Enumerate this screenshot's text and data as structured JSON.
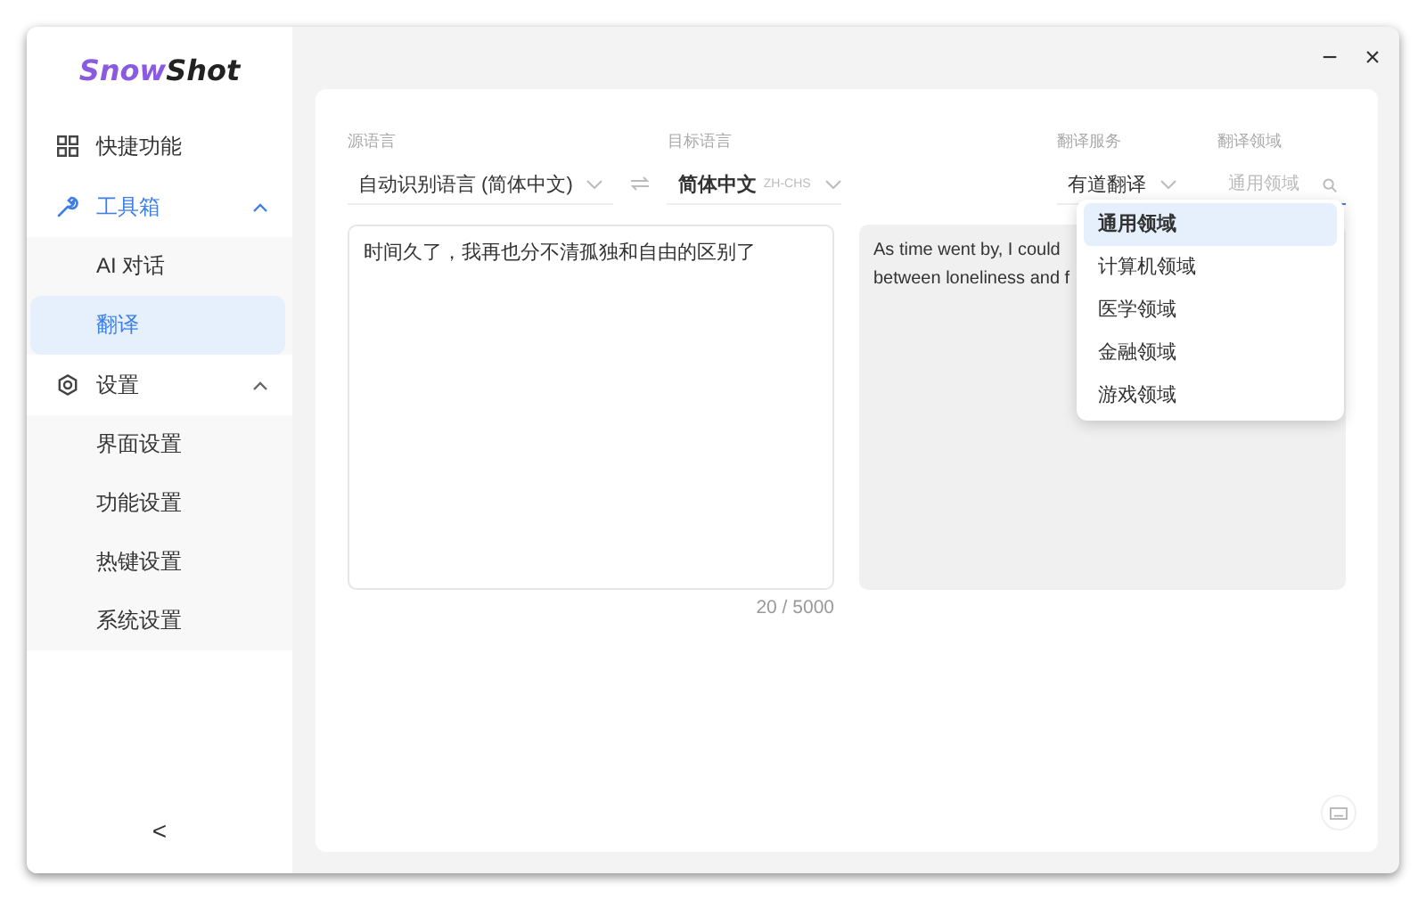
{
  "logo": {
    "part_a": "Snow",
    "part_b": "Shot"
  },
  "sidebar": [
    {
      "label": "快捷功能"
    },
    {
      "label": "工具箱",
      "expanded": true,
      "children": [
        {
          "label": "AI 对话",
          "selected": false
        },
        {
          "label": "翻译",
          "selected": true
        }
      ]
    },
    {
      "label": "设置",
      "expanded": true,
      "children": [
        {
          "label": "界面设置",
          "selected": false
        },
        {
          "label": "功能设置",
          "selected": false
        },
        {
          "label": "热键设置",
          "selected": false
        },
        {
          "label": "系统设置",
          "selected": false
        }
      ]
    }
  ],
  "collapse_button": "<",
  "window_controls": {
    "minimize": "−",
    "close": "×"
  },
  "source_language": {
    "label": "源语言",
    "value": "自动识别语言 (简体中文)"
  },
  "target_language": {
    "label": "目标语言",
    "value": "简体中文",
    "code": "ZH-CHS"
  },
  "service": {
    "label": "翻译服务",
    "value": "有道翻译"
  },
  "domain": {
    "label": "翻译领域",
    "placeholder": "通用领域",
    "open": true,
    "options": [
      {
        "label": "通用领域",
        "selected": true
      },
      {
        "label": "计算机领域",
        "selected": false
      },
      {
        "label": "医学领域",
        "selected": false
      },
      {
        "label": "金融领域",
        "selected": false
      },
      {
        "label": "游戏领域",
        "selected": false
      }
    ]
  },
  "source_text": "时间久了，我再也分不清孤独和自由的区别了",
  "char_count": "20 / 5000",
  "result_lines": [
    "As time went by, I could",
    "between loneliness and f"
  ]
}
